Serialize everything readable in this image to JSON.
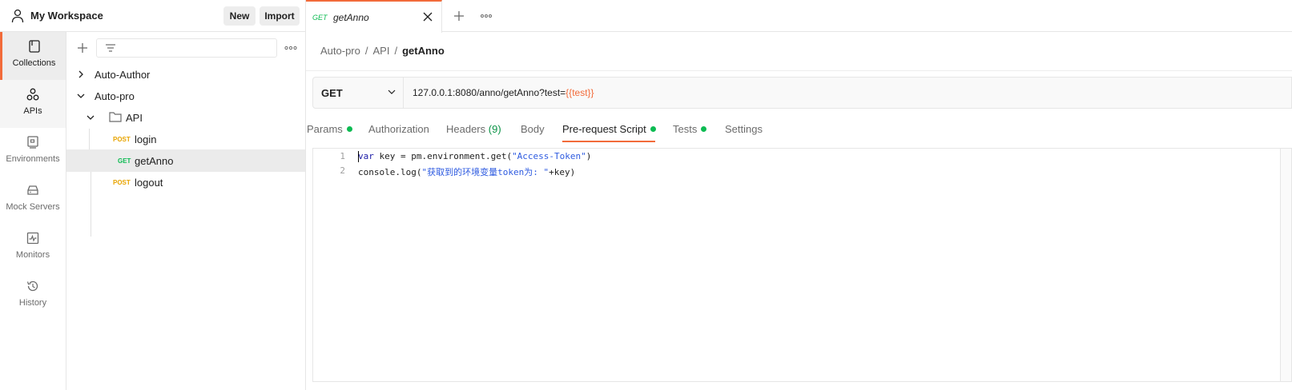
{
  "workspace": {
    "title": "My Workspace",
    "new_label": "New",
    "import_label": "Import"
  },
  "rail": [
    {
      "label": "Collections",
      "icon": "collections-icon"
    },
    {
      "label": "APIs",
      "icon": "apis-icon"
    },
    {
      "label": "Environments",
      "icon": "environments-icon"
    },
    {
      "label": "Mock Servers",
      "icon": "mock-servers-icon"
    },
    {
      "label": "Monitors",
      "icon": "monitors-icon"
    },
    {
      "label": "History",
      "icon": "history-icon"
    }
  ],
  "tree": {
    "items": [
      {
        "label": "Auto-Author",
        "type": "collection",
        "expanded": false
      },
      {
        "label": "Auto-pro",
        "type": "collection",
        "expanded": true
      },
      {
        "label": "API",
        "type": "folder",
        "expanded": true
      },
      {
        "label": "login",
        "type": "request",
        "method": "POST"
      },
      {
        "label": "getAnno",
        "type": "request",
        "method": "GET",
        "selected": true
      },
      {
        "label": "logout",
        "type": "request",
        "method": "POST"
      }
    ]
  },
  "tab": {
    "method": "GET",
    "title": "getAnno"
  },
  "breadcrumb": {
    "parts": [
      "Auto-pro",
      "API"
    ],
    "separator": "/",
    "current": "getAnno"
  },
  "request": {
    "method": "GET",
    "url_base": "127.0.0.1:8080/anno/getAnno?test=",
    "url_var": "{{test}}"
  },
  "req_tabs": [
    {
      "label": "Params",
      "dot": true
    },
    {
      "label": "Authorization"
    },
    {
      "label": "Headers",
      "count": "(9)"
    },
    {
      "label": "Body"
    },
    {
      "label": "Pre-request Script",
      "dot": true,
      "active": true
    },
    {
      "label": "Tests",
      "dot": true
    },
    {
      "label": "Settings"
    }
  ],
  "editor": {
    "line_numbers": [
      "1",
      "2"
    ],
    "line1": {
      "kw": "var",
      "rest": " key = pm.environment.get(",
      "str": "\"Access-Token\"",
      "end": ")"
    },
    "line2": {
      "pre": "console.log(",
      "str": "\"获取到的环境变量token为: \"",
      "end": "+key)"
    }
  },
  "colors": {
    "accent": "#f26b3a",
    "get": "#0cbb52",
    "post": "#e8a400",
    "dot": "#0cbb52"
  }
}
